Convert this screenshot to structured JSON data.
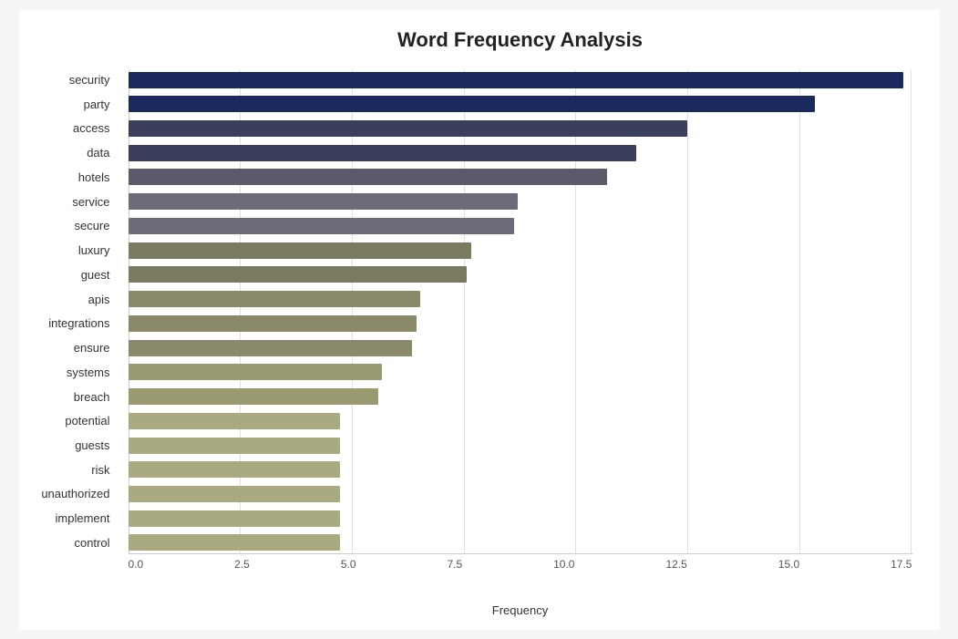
{
  "chart": {
    "title": "Word Frequency Analysis",
    "x_label": "Frequency",
    "x_ticks": [
      "0.0",
      "2.5",
      "5.0",
      "7.5",
      "10.0",
      "12.5",
      "15.0",
      "17.5"
    ],
    "max_value": 18.5,
    "bars": [
      {
        "label": "security",
        "value": 18.3,
        "color": "#1a2a5e"
      },
      {
        "label": "party",
        "value": 16.2,
        "color": "#1a2a5e"
      },
      {
        "label": "access",
        "value": 13.2,
        "color": "#3a3f5c"
      },
      {
        "label": "data",
        "value": 12.0,
        "color": "#3a3f5c"
      },
      {
        "label": "hotels",
        "value": 11.3,
        "color": "#5a5a6a"
      },
      {
        "label": "service",
        "value": 9.2,
        "color": "#6b6b7a"
      },
      {
        "label": "secure",
        "value": 9.1,
        "color": "#6b6b7a"
      },
      {
        "label": "luxury",
        "value": 8.1,
        "color": "#7a7a60"
      },
      {
        "label": "guest",
        "value": 8.0,
        "color": "#7a7a60"
      },
      {
        "label": "apis",
        "value": 6.9,
        "color": "#8a8a6a"
      },
      {
        "label": "integrations",
        "value": 6.8,
        "color": "#8a8a6a"
      },
      {
        "label": "ensure",
        "value": 6.7,
        "color": "#8a8a6a"
      },
      {
        "label": "systems",
        "value": 6.0,
        "color": "#9a9a70"
      },
      {
        "label": "breach",
        "value": 5.9,
        "color": "#9a9a70"
      },
      {
        "label": "potential",
        "value": 5.0,
        "color": "#aaaa80"
      },
      {
        "label": "guests",
        "value": 5.0,
        "color": "#aaaa80"
      },
      {
        "label": "risk",
        "value": 5.0,
        "color": "#aaaa80"
      },
      {
        "label": "unauthorized",
        "value": 5.0,
        "color": "#aaaa80"
      },
      {
        "label": "implement",
        "value": 5.0,
        "color": "#aaaa80"
      },
      {
        "label": "control",
        "value": 5.0,
        "color": "#aaaa80"
      }
    ]
  }
}
